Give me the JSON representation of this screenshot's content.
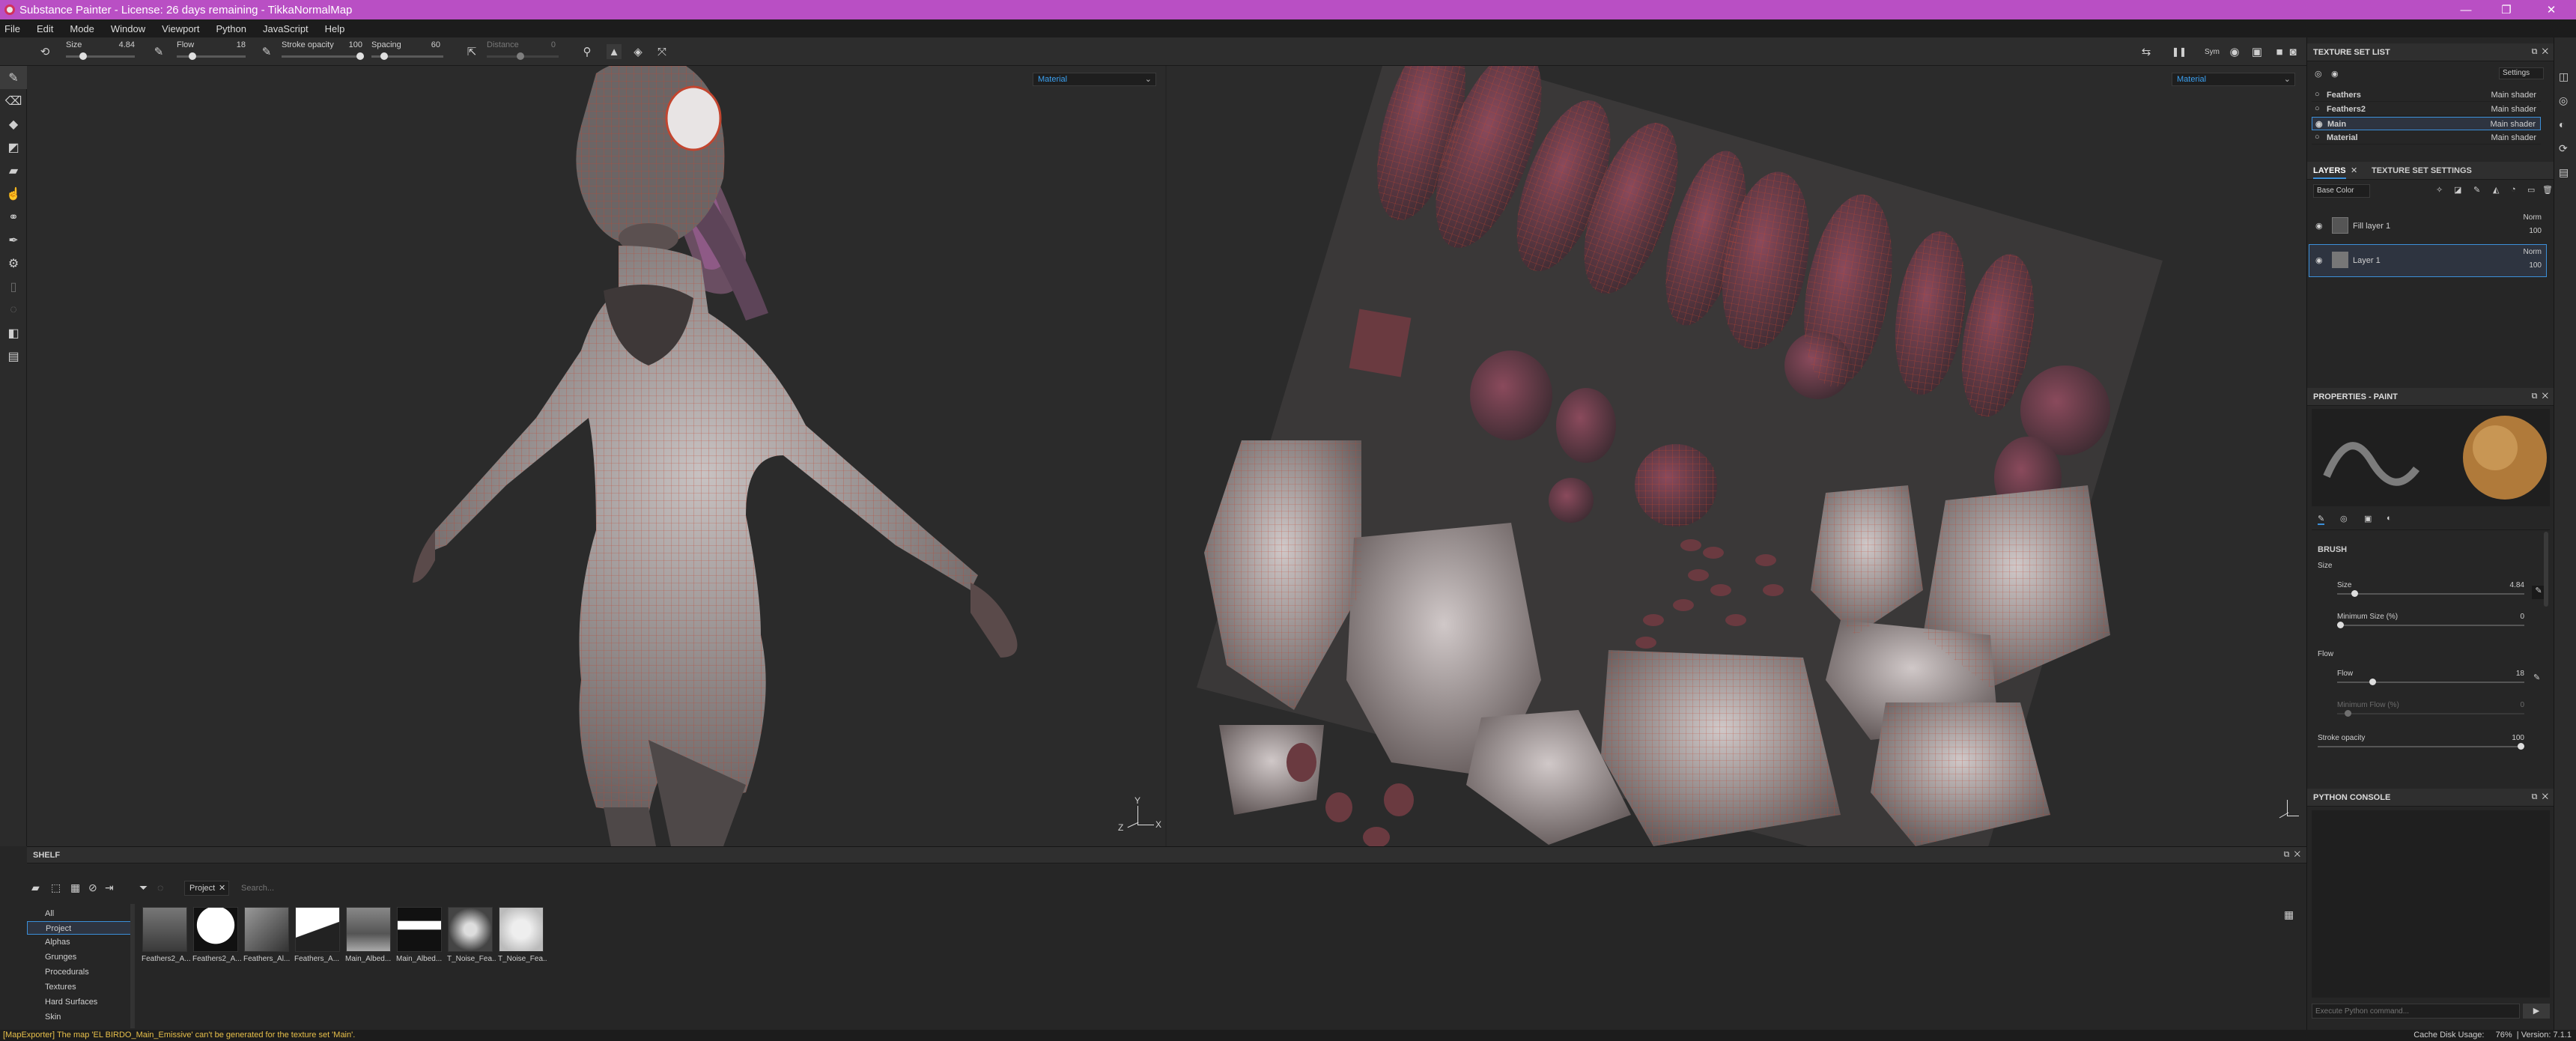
{
  "window": {
    "title": "Substance Painter - License: 26 days remaining - TikkaNormalMap",
    "controls": [
      "—",
      "❐",
      "✕"
    ]
  },
  "menu": [
    "File",
    "Edit",
    "Mode",
    "Window",
    "Viewport",
    "Python",
    "JavaScript",
    "Help"
  ],
  "toolbar": {
    "size_label": "Size",
    "size_value": "4.84",
    "flow_label": "Flow",
    "flow_value": "18",
    "stroke_opacity_label": "Stroke opacity",
    "stroke_opacity_value": "100",
    "spacing_label": "Spacing",
    "spacing_value": "60",
    "distance_label": "Distance",
    "distance_value": "0",
    "sym_label": "Sym"
  },
  "viewport3d": {
    "mode_dropdown": "Material",
    "axis_x": "X",
    "axis_y": "Y",
    "axis_z": "Z"
  },
  "viewport2d": {
    "mode_dropdown": "Material"
  },
  "texture_set_list": {
    "title": "TEXTURE SET LIST",
    "settings_label": "Settings",
    "items": [
      {
        "name": "Feathers",
        "shader": "Main shader"
      },
      {
        "name": "Feathers2",
        "shader": "Main shader"
      },
      {
        "name": "Main",
        "shader": "Main shader"
      },
      {
        "name": "Material",
        "shader": "Main shader"
      }
    ]
  },
  "layers": {
    "tab_layers": "LAYERS",
    "tab_settings": "TEXTURE SET SETTINGS",
    "channel_dropdown": "Base Color",
    "items": [
      {
        "name": "Fill layer 1",
        "blend": "Norm",
        "opacity": "100"
      },
      {
        "name": "Layer 1",
        "blend": "Norm",
        "opacity": "100"
      }
    ]
  },
  "properties": {
    "title": "PROPERTIES - PAINT",
    "brush_section": "BRUSH",
    "size_group": "Size",
    "size_label": "Size",
    "size_value": "4.84",
    "size_fraction": 0.08,
    "min_size_label": "Minimum Size (%)",
    "min_size_value": "0",
    "min_size_fraction": 0.0,
    "flow_group": "Flow",
    "flow_label": "Flow",
    "flow_value": "18",
    "flow_fraction": 0.18,
    "min_flow_label": "Minimum Flow (%)",
    "min_flow_value": "0",
    "min_flow_fraction": 0.04,
    "stroke_opacity_label": "Stroke opacity",
    "stroke_opacity_value": "100",
    "stroke_opacity_fraction": 1.0
  },
  "python_console": {
    "title": "PYTHON CONSOLE",
    "placeholder": "Execute Python command..."
  },
  "shelf": {
    "title": "SHELF",
    "filter_tag": "Project",
    "search_placeholder": "Search...",
    "categories": [
      "All",
      "Project",
      "Alphas",
      "Grunges",
      "Procedurals",
      "Textures",
      "Hard Surfaces",
      "Skin"
    ],
    "selected_category": "Project",
    "thumbnails": [
      "Feathers2_A...",
      "Feathers2_A...",
      "Feathers_Al...",
      "Feathers_A...",
      "Main_Albed...",
      "Main_Albed...",
      "T_Noise_Fea...",
      "T_Noise_Fea..."
    ]
  },
  "status": {
    "message": "[MapExporter] The map 'EL BIRDO_Main_Emissive' can't be generated for the texture set 'Main'.",
    "cache_label": "Cache Disk Usage:",
    "cache_value": "76%",
    "version": "Version: 7.1.1"
  }
}
